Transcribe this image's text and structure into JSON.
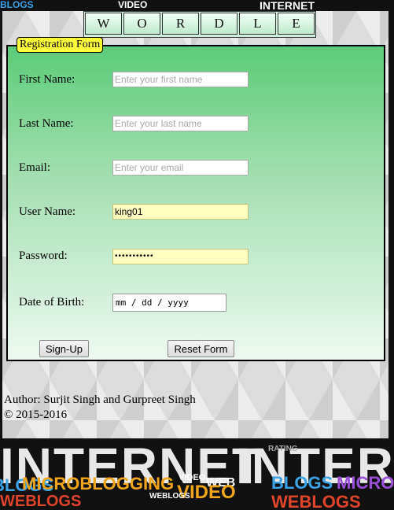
{
  "wordle": [
    "W",
    "O",
    "R",
    "D",
    "L",
    "E"
  ],
  "form": {
    "legend": "Registration Form",
    "first_name": {
      "label": "First Name:",
      "placeholder": "Enter your first name",
      "value": ""
    },
    "last_name": {
      "label": "Last Name:",
      "placeholder": "Enter your last name",
      "value": ""
    },
    "email": {
      "label": "Email:",
      "placeholder": "Enter your email",
      "value": ""
    },
    "user_name": {
      "label": "User Name:",
      "value": "king01"
    },
    "password": {
      "label": "Password:",
      "value": "•••••••••••"
    },
    "dob": {
      "label": "Date of Birth:",
      "value": "mm / dd / yyyy"
    },
    "signup_label": "Sign-Up",
    "reset_label": "Reset Form"
  },
  "footer": {
    "author": "Author: Surjit Singh and Gurpreet Singh",
    "copyright": "© 2015-2016"
  },
  "background_words": [
    "VIDEO",
    "INTERNET",
    "BLOGS",
    "MICROBLOGGING",
    "WEB",
    "WEBLOGS",
    "RATING"
  ],
  "colors": {
    "form_top": "#5ccb78",
    "form_bottom": "#eef9f1",
    "legend_bg": "#ffff3c",
    "autofill_bg": "#ffffc2"
  }
}
